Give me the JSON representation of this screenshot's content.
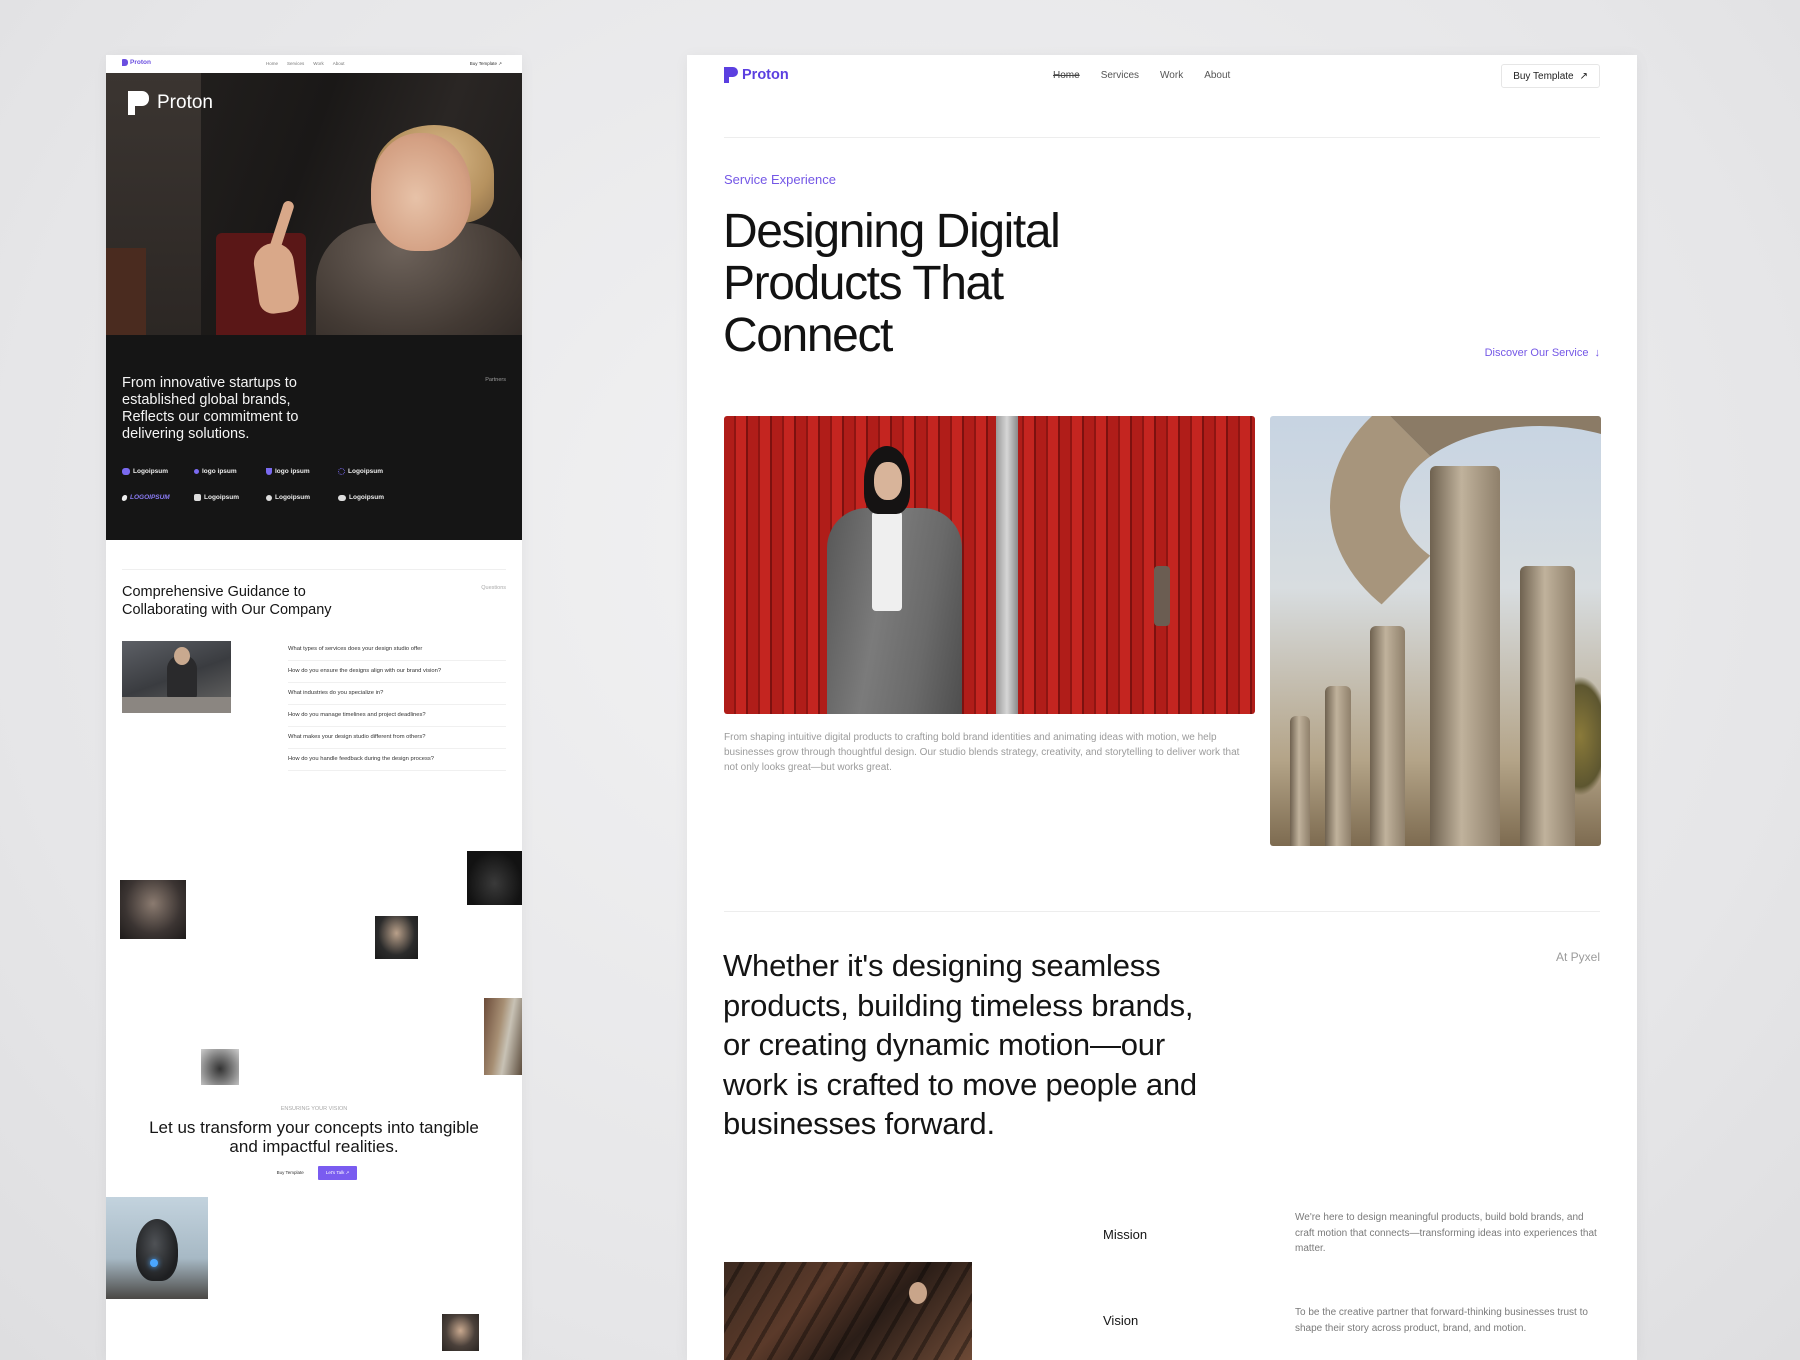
{
  "left_preview": {
    "nav": {
      "brand": "Proton",
      "links": [
        "Home",
        "Services",
        "Work",
        "About"
      ],
      "buy_label": "Buy Template",
      "buy_arrow": "↗"
    },
    "hero": {
      "brand": "Proton"
    },
    "partners": {
      "text": "From innovative startups to established global brands, Reflects our commitment to delivering solutions.",
      "tag": "Partners",
      "logos": [
        "Logoipsum",
        "logo ipsum",
        "logo ipsum",
        "Logoipsum",
        "LOGOIPSUM",
        "Logoipsum",
        "Logoipsum",
        "Logoipsum"
      ]
    },
    "faq": {
      "title": "Comprehensive Guidance to Collaborating with Our Company",
      "tag": "Questions",
      "items": [
        "What types of services does your design studio offer",
        "How do you ensure the designs align with our brand vision?",
        "What industries do you specialize in?",
        "How do you manage timelines and project deadlines?",
        "What makes your design studio different from others?",
        "How do you handle feedback during the design process?"
      ]
    },
    "cta": {
      "eyebrow": "ENSURING YOUR VISION",
      "title": "Let us transform your concepts into tangible and impactful realities.",
      "secondary_label": "Buy Template",
      "primary_label": "Let's Talk ↗"
    }
  },
  "right_page": {
    "nav": {
      "brand": "Proton",
      "links": [
        "Home",
        "Services",
        "Work",
        "About"
      ],
      "active": "Home",
      "buy_label": "Buy Template",
      "buy_arrow": "↗"
    },
    "hero": {
      "eyebrow": "Service Experience",
      "title": "Designing Digital Products That Connect",
      "discover_label": "Discover Our Service",
      "discover_arrow": "↓"
    },
    "caption": "From shaping intuitive digital products to crafting bold brand identities and animating ideas with motion, we help businesses grow through thoughtful design. Our studio blends strategy, creativity, and storytelling to deliver work that not only looks great—but works great.",
    "statement": "Whether it's designing seamless products, building timeless brands, or creating dynamic motion—our work is crafted to move people and businesses forward.",
    "statement_tag": "At Pyxel",
    "mission": {
      "label": "Mission",
      "text": "We're here to design meaningful products, build bold brands, and craft motion that connects—transforming ideas into experiences that matter."
    },
    "vision": {
      "label": "Vision",
      "text": "To be the creative partner that forward-thinking businesses trust to shape their story across product, brand, and motion."
    }
  },
  "colors": {
    "accent": "#6b4fe0",
    "dark_section": "#151515",
    "background": "#e9e9eb"
  }
}
